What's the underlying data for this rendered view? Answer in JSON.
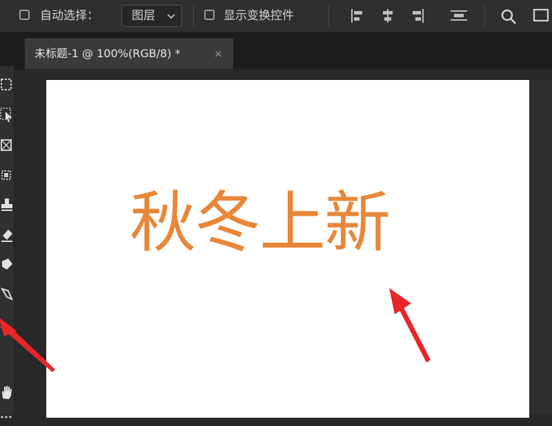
{
  "options_bar": {
    "auto_select_label": "自动选择：",
    "auto_select_value": "图层",
    "transform_controls_label": "显示变换控件",
    "align_icons": [
      "align-left-edges-icon",
      "align-horizontal-centers-icon",
      "align-right-edges-icon",
      "distribute-vertical-icon"
    ],
    "search_icon": "search-icon"
  },
  "document_tab": {
    "title": "未标题-1 @ 100%(RGB/8) *",
    "close_glyph": "×"
  },
  "canvas": {
    "text": "秋冬上新",
    "text_color": "#e8873a",
    "background": "#ffffff"
  },
  "toolbar": {
    "tools": [
      "marquee-tool-icon",
      "object-select-tool-icon",
      "frame-tool-icon",
      "patch-tool-icon",
      "stamp-tool-icon",
      "eraser-tool-icon",
      "paint-bucket-tool-icon",
      "pen-tool-icon",
      "type-tool-icon",
      "hand-tool-icon",
      "more-tools-icon"
    ]
  },
  "annotations": {
    "arrow_color": "#e8262a"
  }
}
